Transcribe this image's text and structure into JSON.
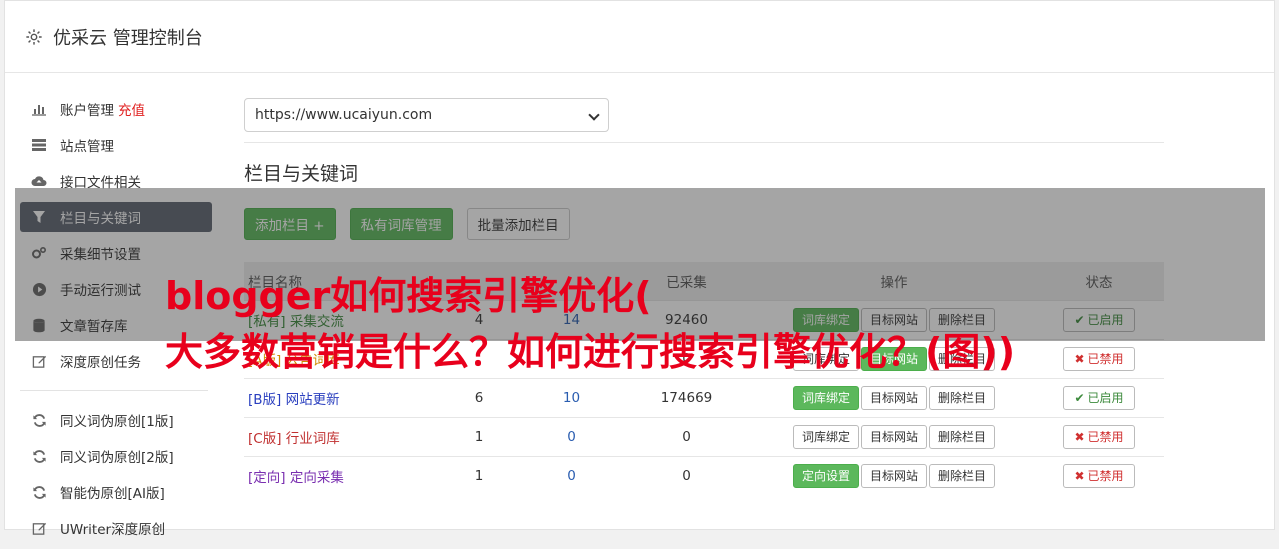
{
  "header": {
    "title": "优采云 管理控制台"
  },
  "sidebar": {
    "items": [
      {
        "label": "账户管理",
        "extra": "充值"
      },
      {
        "label": "站点管理"
      },
      {
        "label": "接口文件相关"
      },
      {
        "label": "栏目与关键词"
      },
      {
        "label": "采集细节设置"
      },
      {
        "label": "手动运行测试"
      },
      {
        "label": "文章暂存库"
      },
      {
        "label": "深度原创任务"
      },
      {
        "label": "同义词伪原创[1版]"
      },
      {
        "label": "同义词伪原创[2版]"
      },
      {
        "label": "智能伪原创[AI版]"
      },
      {
        "label": "UWriter深度原创"
      }
    ]
  },
  "main": {
    "site_select_value": "https://www.ucaiyun.com",
    "section_title": "栏目与关键词",
    "buttons": {
      "add_column": "添加栏目 +",
      "private_lib": "私有词库管理",
      "batch_add": "批量添加栏目"
    },
    "table": {
      "headers": [
        "栏目名称",
        "",
        "",
        "已采集",
        "操作",
        "状态"
      ],
      "rows": [
        {
          "tag": "[私有]",
          "name": "采集交流",
          "c1": "4",
          "c2": "14",
          "c3": "92460",
          "op1": "词库绑定",
          "op2": "目标网站",
          "op3": "删除栏目",
          "status": "已启用"
        },
        {
          "tag": "[A版]",
          "name": "公告词库",
          "c1": "",
          "c2": "",
          "c3": "0",
          "op1": "词库绑定",
          "op2": "目标网站",
          "op3": "删除栏目",
          "status": "已禁用"
        },
        {
          "tag": "[B版]",
          "name": "网站更新",
          "c1": "6",
          "c2": "10",
          "c3": "174669",
          "op1": "词库绑定",
          "op2": "目标网站",
          "op3": "删除栏目",
          "status": "已启用"
        },
        {
          "tag": "[C版]",
          "name": "行业词库",
          "c1": "1",
          "c2": "0",
          "c3": "0",
          "op1": "词库绑定",
          "op2": "目标网站",
          "op3": "删除栏目",
          "status": "已禁用"
        },
        {
          "tag": "[定向]",
          "name": "定向采集",
          "c1": "1",
          "c2": "0",
          "c3": "0",
          "op1": "定向设置",
          "op2": "目标网站",
          "op3": "删除栏目",
          "status": "已禁用"
        }
      ]
    }
  },
  "overlay": {
    "line1": "blogger如何搜索引擎优化(",
    "line2": "大多数营销是什么？如何进行搜索引擎优化？(图))"
  }
}
